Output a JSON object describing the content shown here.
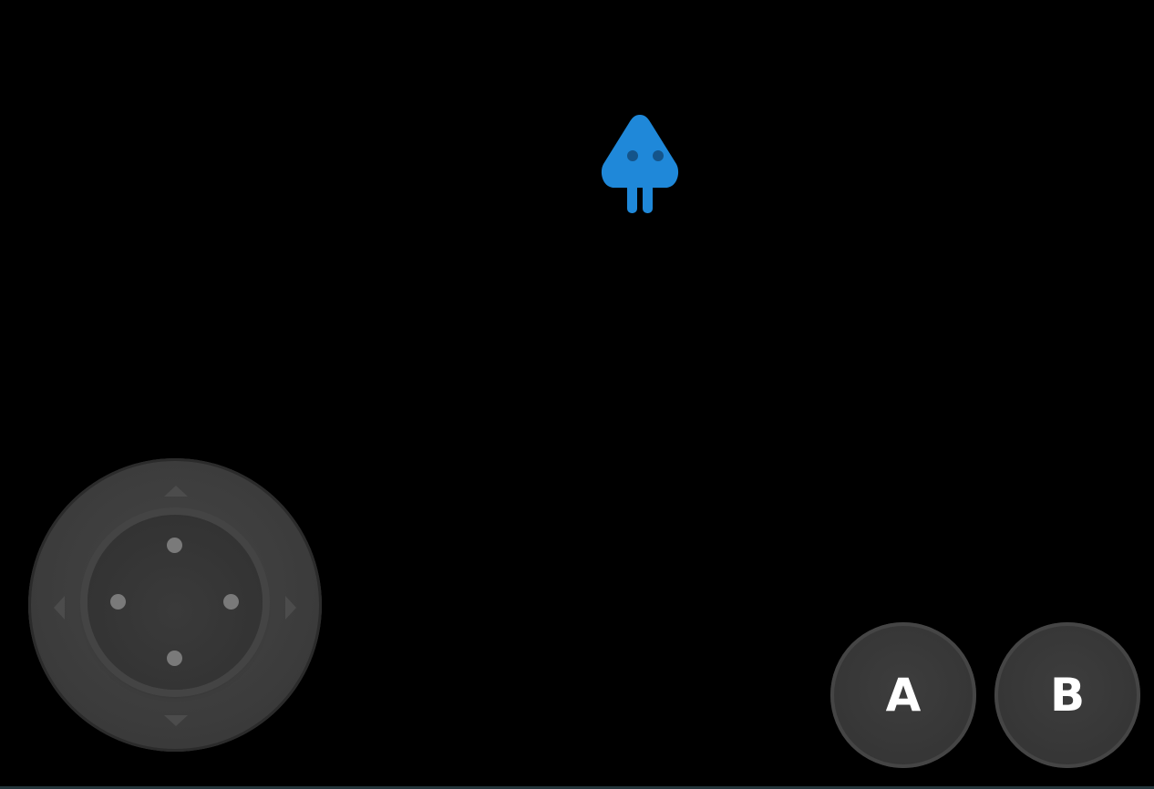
{
  "game": {
    "background_color": "#000000",
    "player": {
      "icon": "player-ship-icon",
      "color": "#1f88d9",
      "eye_color": "#14548a"
    },
    "joystick": {
      "icon": "joystick-icon",
      "arrows": [
        "up",
        "down",
        "left",
        "right"
      ]
    },
    "buttons": {
      "a_label": "A",
      "b_label": "B"
    }
  }
}
